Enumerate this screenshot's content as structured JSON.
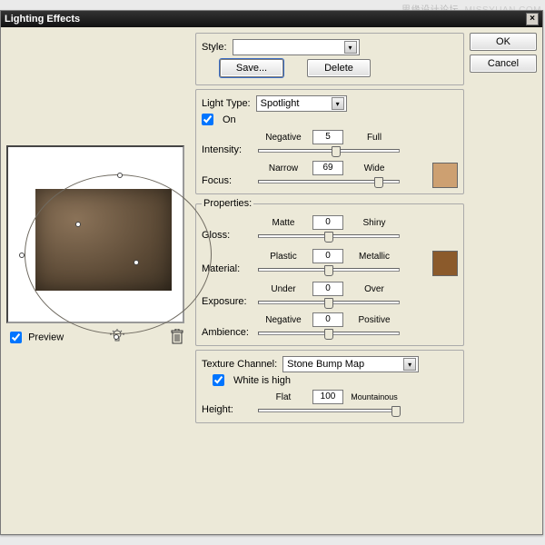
{
  "window": {
    "title": "Lighting Effects"
  },
  "buttons": {
    "ok": "OK",
    "cancel": "Cancel",
    "save": "Save...",
    "delete": "Delete"
  },
  "style": {
    "label": "Style:",
    "value": ""
  },
  "light": {
    "type_label": "Light Type:",
    "type_value": "Spotlight",
    "on_label": "On",
    "on_checked": true,
    "intensity": {
      "name": "Intensity:",
      "left": "Negative",
      "right": "Full",
      "value": "5",
      "pos_pct": 55
    },
    "focus": {
      "name": "Focus:",
      "left": "Narrow",
      "right": "Wide",
      "value": "69",
      "pos_pct": 86
    },
    "color": "#cda071"
  },
  "properties": {
    "legend": "Properties:",
    "gloss": {
      "name": "Gloss:",
      "left": "Matte",
      "right": "Shiny",
      "value": "0",
      "pos_pct": 50
    },
    "material": {
      "name": "Material:",
      "left": "Plastic",
      "right": "Metallic",
      "value": "0",
      "pos_pct": 50
    },
    "exposure": {
      "name": "Exposure:",
      "left": "Under",
      "right": "Over",
      "value": "0",
      "pos_pct": 50
    },
    "ambience": {
      "name": "Ambience:",
      "left": "Negative",
      "right": "Positive",
      "value": "0",
      "pos_pct": 50
    },
    "color": "#8b5a2b"
  },
  "texture": {
    "channel_label": "Texture Channel:",
    "channel_value": "Stone Bump Map",
    "white_high_label": "White is high",
    "white_high_checked": true,
    "height": {
      "name": "Height:",
      "left": "Flat",
      "right": "Mountainous",
      "value": "100",
      "pos_pct": 98
    }
  },
  "preview": {
    "label": "Preview",
    "checked": true
  },
  "watermark": {
    "text": "思缘设计论坛",
    "url": " .MISSYUAN.COM"
  }
}
